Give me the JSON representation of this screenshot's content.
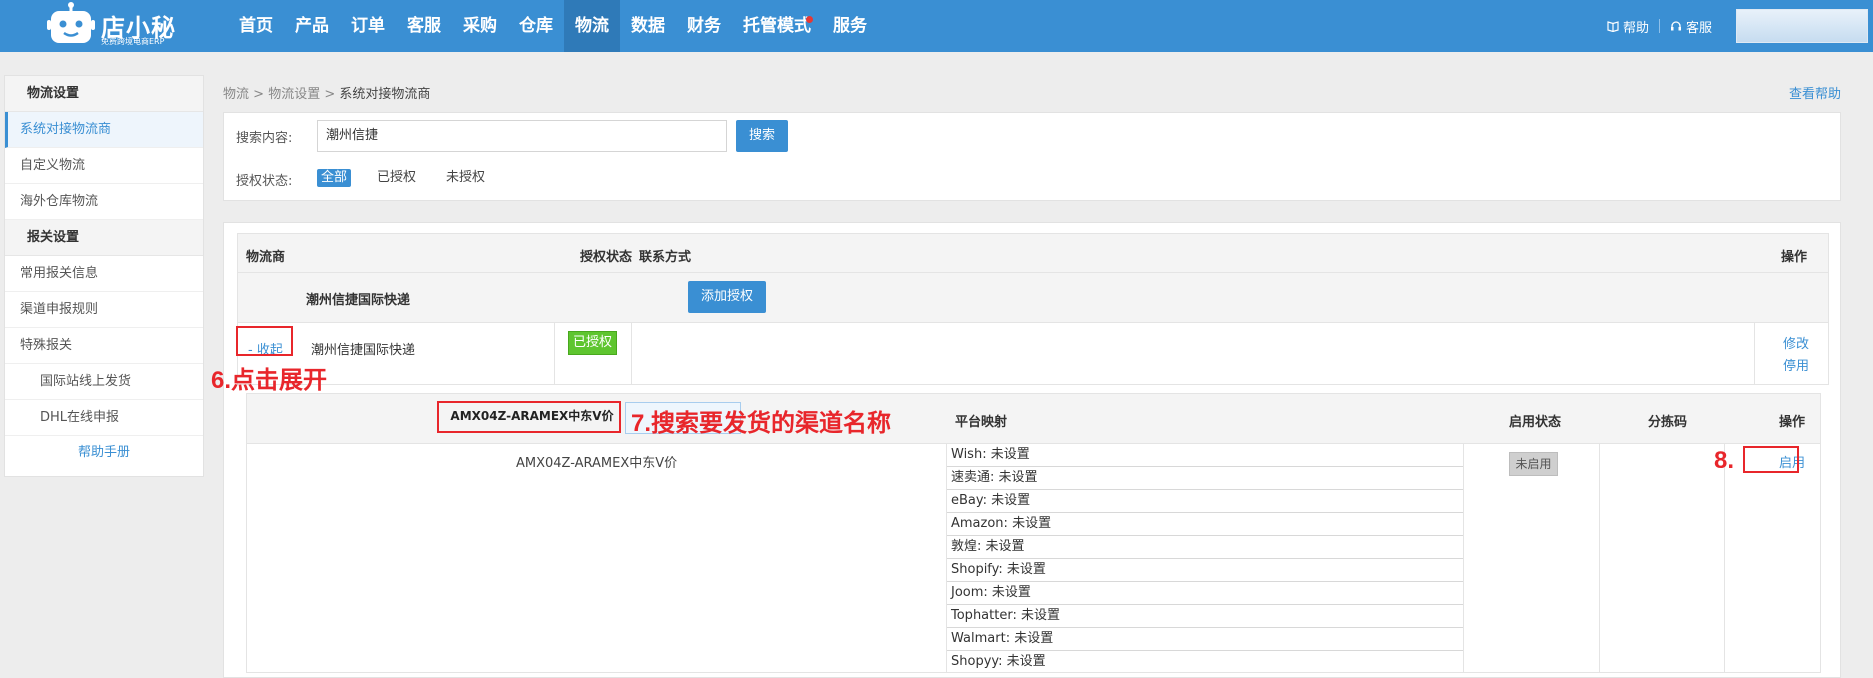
{
  "logo": {
    "name": "店小秘",
    "subtitle": "免费跨境电商ERP"
  },
  "nav": [
    "首页",
    "产品",
    "订单",
    "客服",
    "采购",
    "仓库",
    "物流",
    "数据",
    "财务",
    "托管模式",
    "服务"
  ],
  "nav_active": "物流",
  "top_right": {
    "help": "帮助",
    "service": "客服"
  },
  "sidebar": {
    "groups": [
      {
        "title": "物流设置",
        "items": [
          "系统对接物流商",
          "自定义物流",
          "海外仓库物流"
        ]
      },
      {
        "title": "报关设置",
        "items": [
          "常用报关信息",
          "渠道申报规则",
          "特殊报关",
          "国际站线上发货",
          "DHL在线申报"
        ]
      }
    ],
    "help_link": "帮助手册"
  },
  "breadcrumb": {
    "items": [
      "物流",
      "物流设置"
    ],
    "separator": ">",
    "current": "系统对接物流商"
  },
  "view_help": "查看帮助",
  "search": {
    "label": "搜索内容:",
    "value": "潮州信捷",
    "button": "搜索",
    "status_label": "授权状态:",
    "filters": [
      "全部",
      "已授权",
      "未授权"
    ]
  },
  "table": {
    "headers": {
      "carrier": "物流商",
      "auth_status": "授权状态",
      "contact": "联系方式",
      "operation": "操作"
    },
    "company_name": "潮州信捷国际快递",
    "add_auth_button": "添加授权",
    "row": {
      "collapse": "- 收起",
      "account_name": "潮州信捷国际快递",
      "status_badge": "已授权",
      "edit": "修改",
      "disable": "停用"
    }
  },
  "channel_table": {
    "search_value": "AMX04Z-ARAMEX中东V价",
    "headers": {
      "mapping": "平台映射",
      "enable_status": "启用状态",
      "sort_code": "分拣码",
      "operation": "操作"
    },
    "channel_name": "AMX04Z-ARAMEX中东V价",
    "mappings": [
      {
        "platform": "Wish",
        "value": "未设置"
      },
      {
        "platform": "速卖通",
        "value": "未设置"
      },
      {
        "platform": "eBay",
        "value": "未设置"
      },
      {
        "platform": "Amazon",
        "value": "未设置"
      },
      {
        "platform": "敦煌",
        "value": "未设置"
      },
      {
        "platform": "Shopify",
        "value": "未设置"
      },
      {
        "platform": "Joom",
        "value": "未设置"
      },
      {
        "platform": "Tophatter",
        "value": "未设置"
      },
      {
        "platform": "Walmart",
        "value": "未设置"
      },
      {
        "platform": "Shopyy",
        "value": "未设置"
      }
    ],
    "status_badge": "未启用",
    "enable_button": "启用"
  },
  "annotations": {
    "step6": "6.点击展开",
    "step7": "7.搜索要发货的渠道名称",
    "step8": "8."
  },
  "colors": {
    "brand": "#3a8fd3",
    "annotation": "#e8262b",
    "authorized": "#5ec52f"
  }
}
